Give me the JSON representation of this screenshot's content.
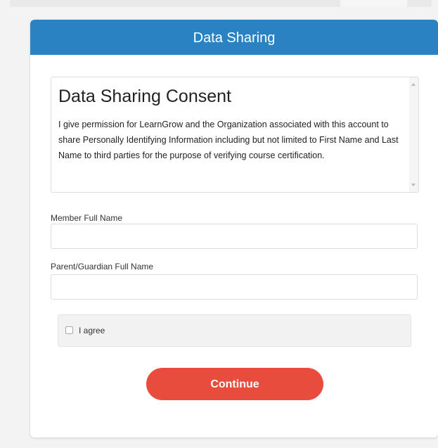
{
  "modal": {
    "title": "Data Sharing"
  },
  "consent": {
    "heading": "Data Sharing Consent",
    "body": "I give permission for LearnGrow and the Organization associated with this account to share Personally Identifying Information including but not limited to First Name and Last Name to third parties for the purpose of verifying course certification."
  },
  "form": {
    "member_label": "Member Full Name",
    "member_value": "",
    "guardian_label": "Parent/Guardian Full Name",
    "guardian_value": "",
    "agree_label": "I agree",
    "agree_checked": false
  },
  "actions": {
    "continue_label": "Continue"
  },
  "colors": {
    "header_bg": "#2b82c2",
    "button_bg": "#e84c3d"
  },
  "icons": {
    "scroll_up": "scroll-up-arrow-icon",
    "scroll_down": "scroll-down-arrow-icon"
  }
}
